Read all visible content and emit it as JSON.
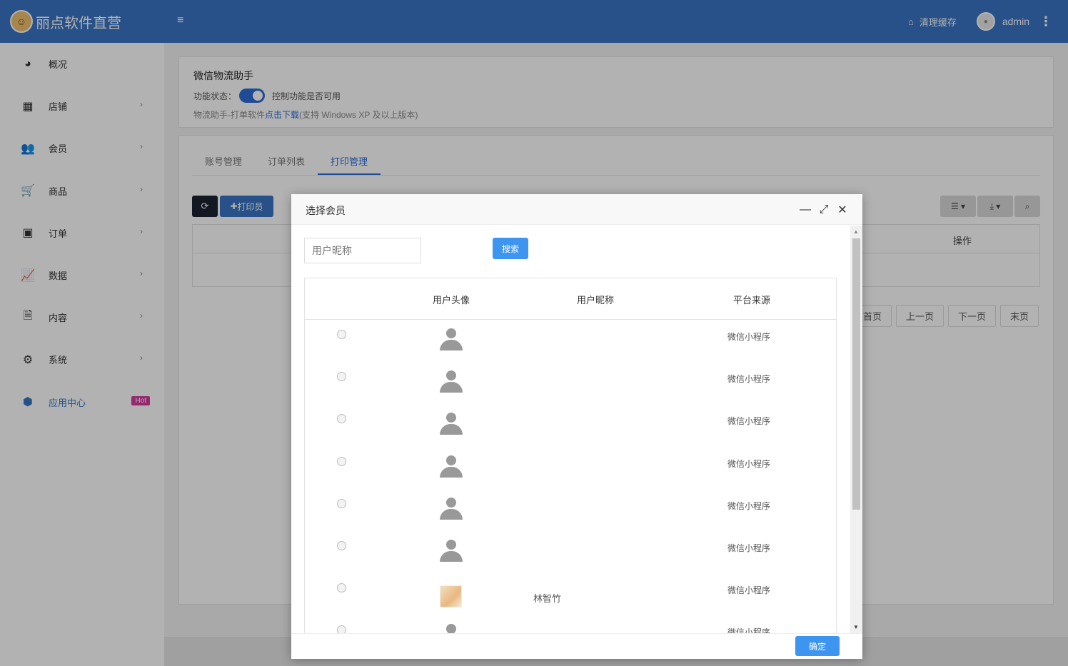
{
  "app": {
    "title": "丽点软件直营",
    "logo_icon": "mascot-icon"
  },
  "header": {
    "clear_cache": "清理缓存",
    "user": "admin"
  },
  "sidebar": {
    "items": [
      {
        "label": "概况",
        "icon": "dashboard-icon",
        "glyph": "◕"
      },
      {
        "label": "店铺",
        "icon": "grid-icon",
        "glyph": "▦"
      },
      {
        "label": "会员",
        "icon": "users-icon",
        "glyph": "👥"
      },
      {
        "label": "商品",
        "icon": "cart-icon",
        "glyph": "🛒"
      },
      {
        "label": "订单",
        "icon": "money-icon",
        "glyph": "▣"
      },
      {
        "label": "数据",
        "icon": "chart-line-icon",
        "glyph": "📈"
      },
      {
        "label": "内容",
        "icon": "document-icon",
        "glyph": "🗎"
      },
      {
        "label": "系统",
        "icon": "gear-icon",
        "glyph": "⚙"
      },
      {
        "label": "应用中心",
        "icon": "cube-icon",
        "glyph": "⬢",
        "badge": "Hot"
      }
    ]
  },
  "panel": {
    "title": "微信物流助手",
    "status_label": "功能状态：",
    "status_desc": "控制功能是否可用",
    "download_prefix": "物流助手-打单软件",
    "download_link": "点击下载",
    "download_suffix": "(支持 Windows XP 及以上版本)"
  },
  "tabs": [
    "账号管理",
    "订单列表",
    "打印管理"
  ],
  "toolbar": {
    "add_label": "打印员"
  },
  "bg_table": {
    "op_header": "操作"
  },
  "pager": [
    "首页",
    "上一页",
    "下一页",
    "末页"
  ],
  "modal": {
    "title": "选择会员",
    "search_placeholder": "用户昵称",
    "search_btn": "搜索",
    "columns": [
      "用户头像",
      "用户昵称",
      "平台来源"
    ],
    "rows": [
      {
        "nickname": "",
        "source": "微信小程序",
        "avatar": "default"
      },
      {
        "nickname": "",
        "source": "微信小程序",
        "avatar": "default"
      },
      {
        "nickname": "",
        "source": "微信小程序",
        "avatar": "default"
      },
      {
        "nickname": "",
        "source": "微信小程序",
        "avatar": "default"
      },
      {
        "nickname": "",
        "source": "微信小程序",
        "avatar": "default"
      },
      {
        "nickname": "",
        "source": "微信小程序",
        "avatar": "default"
      },
      {
        "nickname": "林智竹",
        "source": "微信小程序",
        "avatar": "photo"
      },
      {
        "nickname": "",
        "source": "微信小程序",
        "avatar": "default"
      }
    ],
    "ok_btn": "确定"
  },
  "colors": {
    "primary": "#3a74c4",
    "accent": "#3e95f0",
    "badge": "#d63ba0"
  }
}
